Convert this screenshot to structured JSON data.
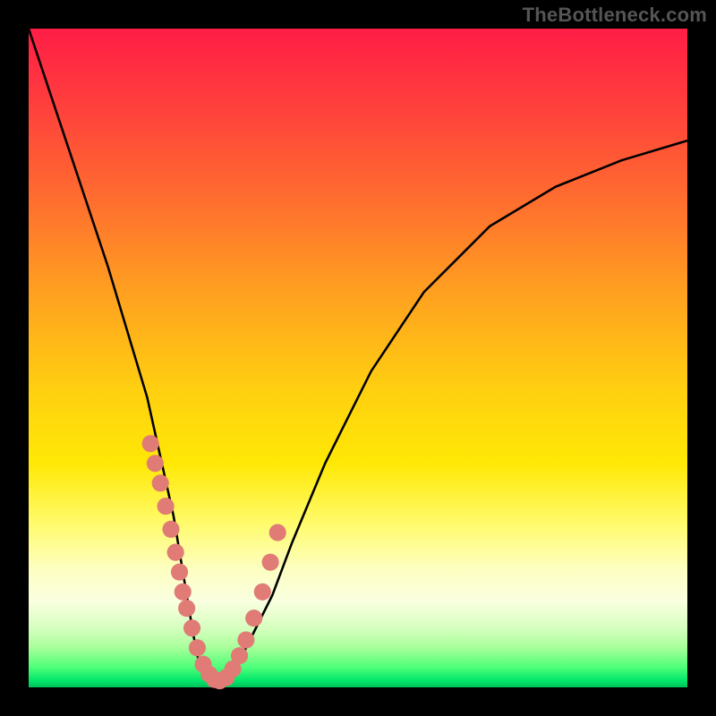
{
  "watermark": "TheBottleneck.com",
  "chart_data": {
    "type": "line",
    "title": "",
    "xlabel": "",
    "ylabel": "",
    "xlim": [
      0,
      100
    ],
    "ylim": [
      0,
      100
    ],
    "grid": false,
    "series": [
      {
        "name": "curve",
        "x": [
          0,
          4,
          8,
          12,
          15,
          18,
          20,
          22,
          23,
          24,
          25,
          26,
          27,
          28,
          30,
          32,
          34,
          37,
          40,
          45,
          52,
          60,
          70,
          80,
          90,
          100
        ],
        "y": [
          100,
          88,
          76,
          64,
          54,
          44,
          35,
          26,
          20,
          14,
          8,
          3,
          1,
          1,
          2,
          4,
          8,
          14,
          22,
          34,
          48,
          60,
          70,
          76,
          80,
          83
        ]
      }
    ],
    "markers": {
      "name": "dots",
      "color": "#e07b76",
      "radius": 1.3,
      "x": [
        18.5,
        19.2,
        20.0,
        20.8,
        21.6,
        22.3,
        22.9,
        23.4,
        24.0,
        24.8,
        25.6,
        26.5,
        27.4,
        28.2,
        29.0,
        30.0,
        31.0,
        32.0,
        33.0,
        34.2,
        35.5,
        36.7,
        37.8
      ],
      "y": [
        37,
        34,
        31,
        27.5,
        24,
        20.5,
        17.5,
        14.5,
        12,
        9,
        6,
        3.5,
        2,
        1.2,
        1.0,
        1.5,
        2.8,
        4.8,
        7.2,
        10.5,
        14.5,
        19,
        23.5
      ]
    },
    "gradient_stops": [
      {
        "pos": 0,
        "color": "#ff1d46"
      },
      {
        "pos": 10,
        "color": "#ff3a3e"
      },
      {
        "pos": 25,
        "color": "#ff6a30"
      },
      {
        "pos": 40,
        "color": "#ffa020"
      },
      {
        "pos": 55,
        "color": "#ffd010"
      },
      {
        "pos": 66,
        "color": "#ffe805"
      },
      {
        "pos": 75,
        "color": "#fffb6a"
      },
      {
        "pos": 82,
        "color": "#fdffc0"
      },
      {
        "pos": 87,
        "color": "#f9ffe0"
      },
      {
        "pos": 91,
        "color": "#d6ffbf"
      },
      {
        "pos": 94,
        "color": "#a7ff9a"
      },
      {
        "pos": 97,
        "color": "#4dff78"
      },
      {
        "pos": 99,
        "color": "#00e66a"
      },
      {
        "pos": 100,
        "color": "#00c05a"
      }
    ]
  }
}
